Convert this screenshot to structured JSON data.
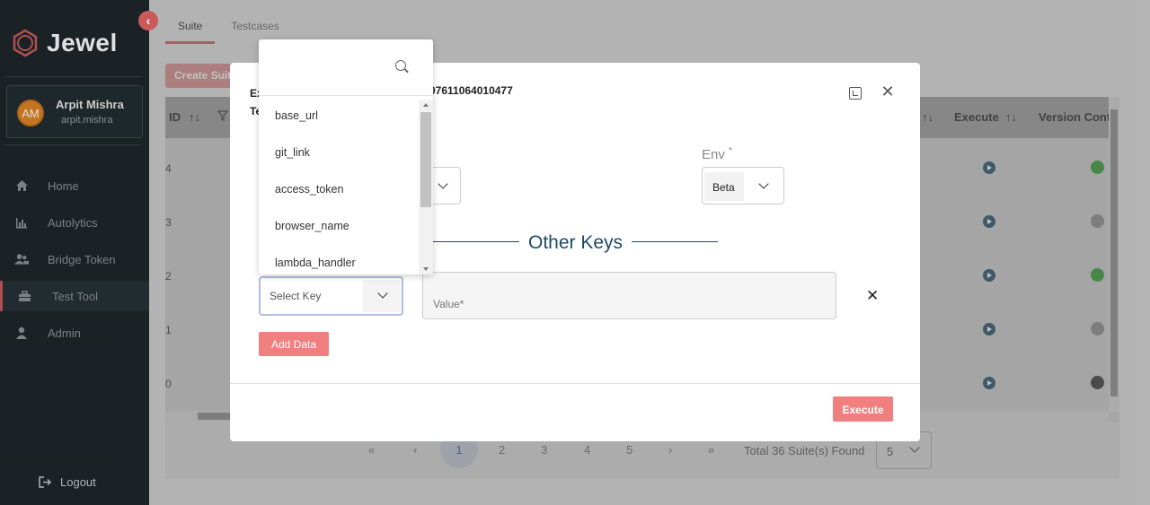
{
  "app": {
    "name": "Jewel"
  },
  "user": {
    "initials": "AM",
    "name": "Arpit Mishra",
    "username": "arpit.mishra"
  },
  "sidebar": {
    "items": [
      {
        "label": "Home",
        "icon": "home-icon"
      },
      {
        "label": "Autolytics",
        "icon": "bar-chart-icon"
      },
      {
        "label": "Bridge Token",
        "icon": "users-icon"
      },
      {
        "label": "Test Tool",
        "icon": "toolbox-icon",
        "active": true
      },
      {
        "label": "Admin",
        "icon": "user-icon"
      }
    ],
    "logout": "Logout"
  },
  "main": {
    "tabs": [
      {
        "label": "Suite",
        "active": true
      },
      {
        "label": "Testcases"
      }
    ],
    "create_button": "Create Suite",
    "table": {
      "headers": {
        "id": "ID",
        "execute": "Execute",
        "version_control": "Version Control"
      },
      "row_ids": [
        "4",
        "3",
        "2",
        "1",
        "0"
      ],
      "github_colors": [
        "#2e9a2e",
        "#888888",
        "#2e9a2e",
        "#888888",
        "#333333"
      ]
    },
    "pagination": {
      "first": "«",
      "prev": "‹",
      "pages": [
        "1",
        "2",
        "3",
        "4",
        "5"
      ],
      "active_page": "1",
      "next": "›",
      "last": "»",
      "total": "Total 36 Suite(s) Found",
      "per_page": "5"
    }
  },
  "modal": {
    "title_line1": "Ex",
    "title_line2": "Te",
    "id_text": "97611064010477",
    "env": {
      "label": "Env",
      "required": "*",
      "value": "Beta"
    },
    "other_keys_title": "Other Keys",
    "select_key_placeholder": "Select Key",
    "value_placeholder": "Value*",
    "add_data_button": "Add Data",
    "execute_button": "Execute"
  },
  "dropdown": {
    "search_placeholder": "",
    "options": [
      "base_url",
      "git_link",
      "access_token",
      "browser_name",
      "lambda_handler"
    ]
  },
  "colors": {
    "accent": "#f08080",
    "sidebar_bg": "#1e272c",
    "title_blue": "#1e4a66"
  }
}
